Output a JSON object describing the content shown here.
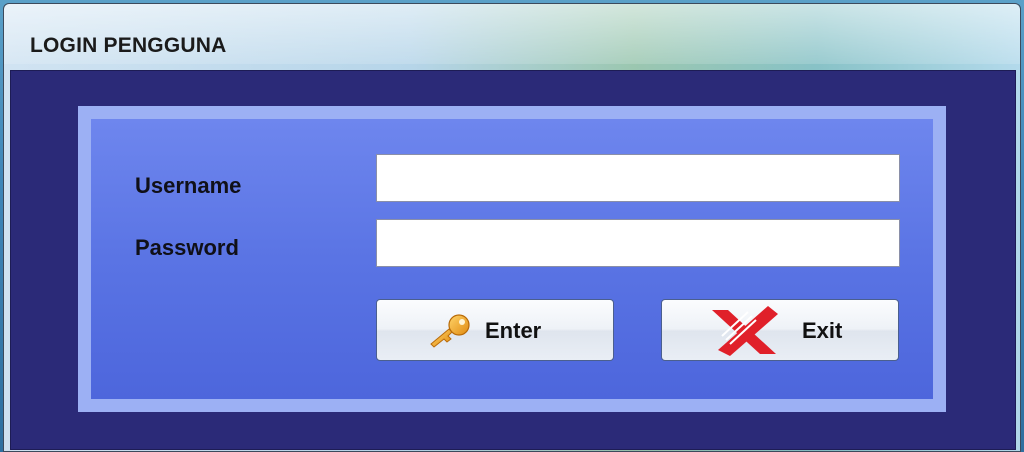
{
  "window": {
    "title": "LOGIN PENGGUNA"
  },
  "form": {
    "username_label": "Username",
    "username_value": "",
    "password_label": "Password",
    "password_value": ""
  },
  "buttons": {
    "enter_label": "Enter",
    "enter_icon": "key-icon",
    "exit_label": "Exit",
    "exit_icon": "red-x-icon"
  },
  "colors": {
    "client_background": "#2b2a78",
    "panel_border": "#9cb0f4",
    "panel_fill": "#5a74e4",
    "exit_icon": "#e0202a",
    "key_icon": "#f0a020"
  }
}
